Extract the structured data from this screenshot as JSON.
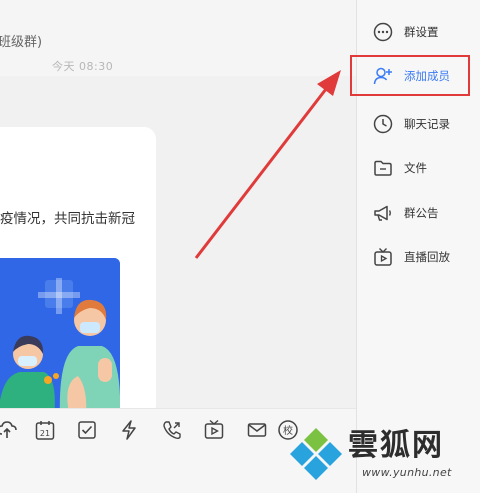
{
  "chat": {
    "title": "班级群)",
    "time": "今天 08:30",
    "message_text": "疫情况，共同抗击新冠"
  },
  "side_menu": {
    "items": [
      {
        "label": "群设置",
        "icon": "more-circle-icon"
      },
      {
        "label": "添加成员",
        "icon": "add-user-icon"
      },
      {
        "label": "聊天记录",
        "icon": "clock-icon"
      },
      {
        "label": "文件",
        "icon": "folder-icon"
      },
      {
        "label": "群公告",
        "icon": "megaphone-icon"
      },
      {
        "label": "直播回放",
        "icon": "tv-icon"
      }
    ]
  },
  "toolbar": {
    "calendar_day": "21",
    "school_label": "校",
    "icons": [
      "cloud-upload-icon",
      "calendar-icon",
      "checkbox-icon",
      "lightning-icon",
      "phone-video-icon",
      "tv-play-icon",
      "mail-icon",
      "school-icon",
      "more-icon"
    ]
  },
  "watermark": {
    "name": "雲狐网",
    "url": "www.yunhu.net"
  },
  "colors": {
    "accent": "#3b7bf6",
    "highlight_red": "#e03a3a",
    "image_blue": "#2f67e6"
  }
}
